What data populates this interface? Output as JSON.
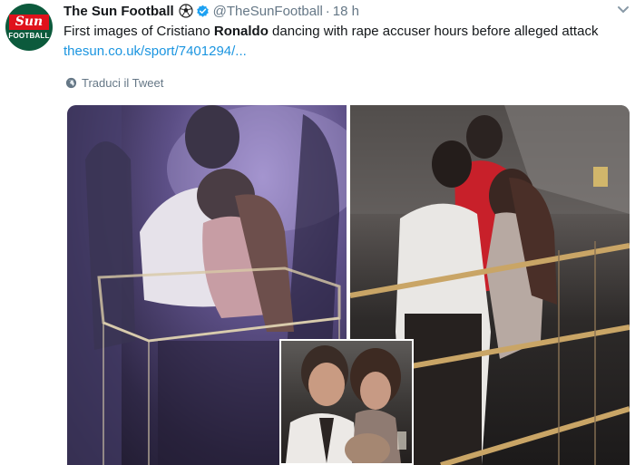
{
  "tweet": {
    "author_name": "The Sun Football",
    "handle": "@TheSunFootball",
    "separator": "·",
    "time": "18 h",
    "text_part1": "First images of Cristiano ",
    "text_bold": "Ronaldo",
    "text_part2": " dancing with rape accuser hours before alleged attack ",
    "link_text": "thesun.co.uk/sport/7401294/...",
    "translate_label": "Traduci il Tweet"
  },
  "avatar": {
    "logo_text": "Sun",
    "logo_subtext": "FOOTBALL"
  },
  "icons": {
    "ball": "soccer-ball-icon",
    "verified": "verified-badge-icon",
    "caret": "chevron-down-icon",
    "globe": "globe-icon"
  },
  "colors": {
    "link": "#1b95e0",
    "muted": "#657786",
    "verified": "#1da1f2",
    "avatar_bg": "#0c5a3c",
    "sun_red": "#e0121b"
  }
}
